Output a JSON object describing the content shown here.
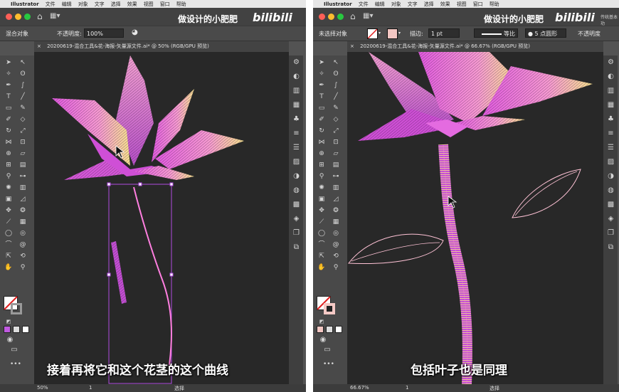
{
  "left": {
    "menu": [
      "Illustrator",
      "文件",
      "编辑",
      "对象",
      "文字",
      "选择",
      "效果",
      "视图",
      "窗口",
      "帮助"
    ],
    "watermark": "做设计的小肥肥",
    "bili": "bilibili",
    "control": {
      "selection_label": "混合对象",
      "opacity_label": "不透明度:",
      "opacity_value": "100%"
    },
    "doc_tab": "20200619-混合工具&花-海报-矢量源文件.ai* @ 50% (RGB/GPU 预览)",
    "subtitle": "接着再将它和这个花茎的这个曲线",
    "status": {
      "zoom": "50%",
      "page": "1",
      "mode": "选择"
    }
  },
  "right": {
    "menu": [
      "Illustrator",
      "文件",
      "编辑",
      "对象",
      "文字",
      "选择",
      "效果",
      "视图",
      "窗口",
      "帮助"
    ],
    "watermark": "做设计的小肥肥",
    "bili": "bilibili",
    "top_right_text": "传统基本功",
    "control": {
      "selection_label": "未选择对象",
      "stroke_label": "描边:",
      "stroke_value": "1 pt",
      "profile_label": "等比",
      "brush_label": "5 点圆形",
      "opacity_label": "不透明度"
    },
    "doc_tab": "20200619-混合工具&花-海报-矢量源文件.ai* @ 66.67% (RGB/GPU 预览)",
    "subtitle": "包括叶子也是同理",
    "status": {
      "zoom": "66.67%",
      "page": "1",
      "mode": "选择"
    }
  },
  "colors": {
    "pink": "#ff6fd8",
    "magenta": "#b84ad8",
    "yellow": "#ffe58a",
    "canvas": "#282828"
  }
}
